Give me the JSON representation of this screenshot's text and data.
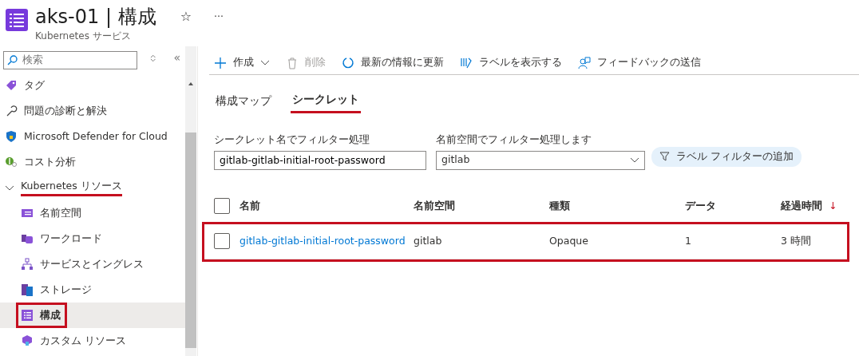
{
  "header": {
    "title": "aks-01",
    "separator": "|",
    "section": "構成",
    "subtitle": "Kubernetes サービス",
    "favorite_glyph": "☆",
    "more_glyph": "···"
  },
  "sidebar": {
    "search": {
      "placeholder": "検索"
    },
    "collapse_glyph": "«",
    "items": [
      {
        "kind": "item",
        "label": "タグ",
        "selected": false,
        "highlighted": false
      },
      {
        "kind": "item",
        "label": "問題の診断と解決",
        "selected": false,
        "highlighted": false
      },
      {
        "kind": "item",
        "label": "Microsoft Defender for Cloud",
        "selected": false,
        "highlighted": false
      },
      {
        "kind": "item",
        "label": "コスト分析",
        "selected": false,
        "highlighted": false
      },
      {
        "kind": "group",
        "label": "Kubernetes リソース",
        "expanded": true,
        "underlined": true,
        "children": [
          {
            "kind": "item",
            "label": "名前空間",
            "selected": false,
            "highlighted": false
          },
          {
            "kind": "item",
            "label": "ワークロード",
            "selected": false,
            "highlighted": false
          },
          {
            "kind": "item",
            "label": "サービスとイングレス",
            "selected": false,
            "highlighted": false
          },
          {
            "kind": "item",
            "label": "ストレージ",
            "selected": false,
            "highlighted": false
          },
          {
            "kind": "item",
            "label": "構成",
            "selected": true,
            "highlighted": true
          },
          {
            "kind": "item",
            "label": "カスタム リソース",
            "selected": false,
            "highlighted": false
          }
        ]
      }
    ]
  },
  "toolbar": [
    {
      "label": "作成",
      "disabled": false,
      "dropdown": true
    },
    {
      "label": "削除",
      "disabled": true,
      "dropdown": false
    },
    {
      "label": "最新の情報に更新",
      "disabled": false,
      "dropdown": false
    },
    {
      "label": "ラベルを表示する",
      "disabled": false,
      "dropdown": false
    },
    {
      "label": "フィードバックの送信",
      "disabled": false,
      "dropdown": false
    }
  ],
  "tabs": [
    {
      "label": "構成マップ",
      "selected": false
    },
    {
      "label": "シークレット",
      "selected": true
    }
  ],
  "filters": {
    "name": {
      "label": "シークレット名でフィルター処理",
      "value": "gitlab-gitlab-initial-root-password"
    },
    "namespace": {
      "label": "名前空間でフィルター処理します",
      "value": "gitlab"
    },
    "add_label_filter": "ラベル フィルターの追加"
  },
  "table": {
    "all_checked": false,
    "columns": [
      "名前",
      "名前空間",
      "種類",
      "データ",
      "経過時間"
    ],
    "sort_glyph": "↓",
    "rows": [
      {
        "cells": [
          "gitlab-gitlab-initial-root-password",
          "gitlab",
          "Opaque",
          "1",
          "3 時間"
        ],
        "checked": false,
        "highlighted": true
      }
    ]
  }
}
